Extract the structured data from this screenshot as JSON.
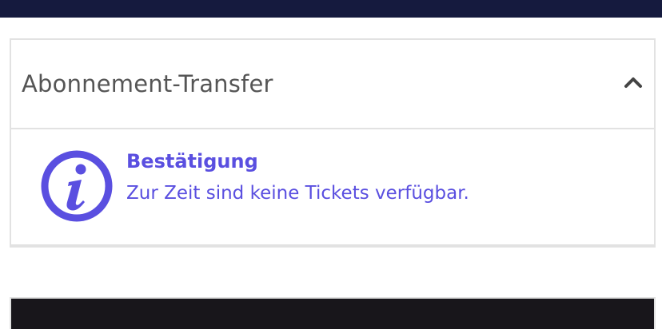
{
  "panel": {
    "title": "Abonnement-Transfer",
    "collapse_icon": "chevron-up-icon"
  },
  "message": {
    "icon": "info-icon",
    "title": "Bestätigung",
    "text": "Zur Zeit sind keine Tickets verfügbar."
  },
  "colors": {
    "top_bar": "#151a3e",
    "accent": "#5a4fe0",
    "bottom_bar": "#18161b"
  }
}
